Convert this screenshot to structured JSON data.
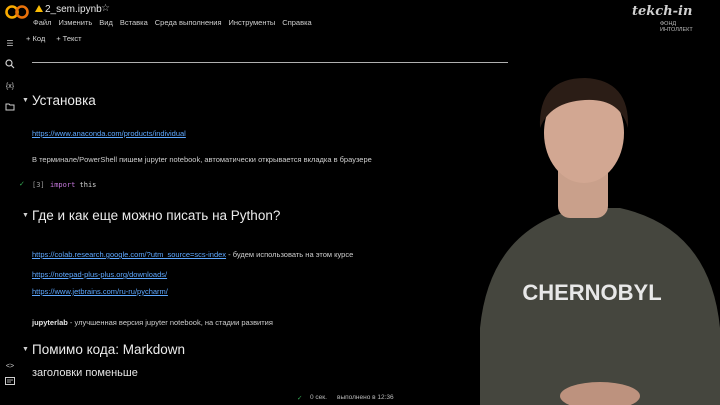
{
  "header": {
    "file_name": "2_sem.ipynb",
    "star_icon": "star-outline-icon"
  },
  "menu": [
    "Файл",
    "Изменить",
    "Вид",
    "Вставка",
    "Среда выполнения",
    "Инструменты",
    "Справка"
  ],
  "toolbar": {
    "add_code": "+ Код",
    "add_text": "+ Текст"
  },
  "sidebar_icons": [
    "toc-icon",
    "search-icon",
    "variables-icon",
    "folder-icon",
    "code-snippets-icon",
    "terminal-icon"
  ],
  "sections": {
    "install": {
      "title": "Установка",
      "link": "https://www.anaconda.com/products/individual",
      "text": "В терминале/PowerShell пишем jupyter notebook, автоматически открывается вкладка в браузере",
      "cell_exec": "[3]",
      "cell_kw": "import",
      "cell_arg": "this"
    },
    "where": {
      "title": "Где и как еще можно писать на Python?",
      "colab_link": "https://colab.research.google.com/?utm_source=scs-index",
      "colab_note": " - будем использовать на этом курсе",
      "npp_link": "https://notepad-plus-plus.org/downloads/",
      "pycharm_link": "https://www.jetbrains.com/ru-ru/pycharm/",
      "jl_bold": "jupyterlab",
      "jl_note": " - улучшенная версия jupyter notebook, на стадии развития"
    },
    "markdown": {
      "title": "Помимо кода: Markdown",
      "subtitle": "заголовки поменьше"
    }
  },
  "status": {
    "time": "0 сек.",
    "done": "выполнено в 12:36"
  },
  "watermark": {
    "brand": "tekch-in",
    "line1": "ФОНД",
    "line2": "ИНТОЛЛЕКТ"
  },
  "colors": {
    "link": "#5ea8ff",
    "accent": "#f9ab00",
    "check": "#34a853"
  }
}
